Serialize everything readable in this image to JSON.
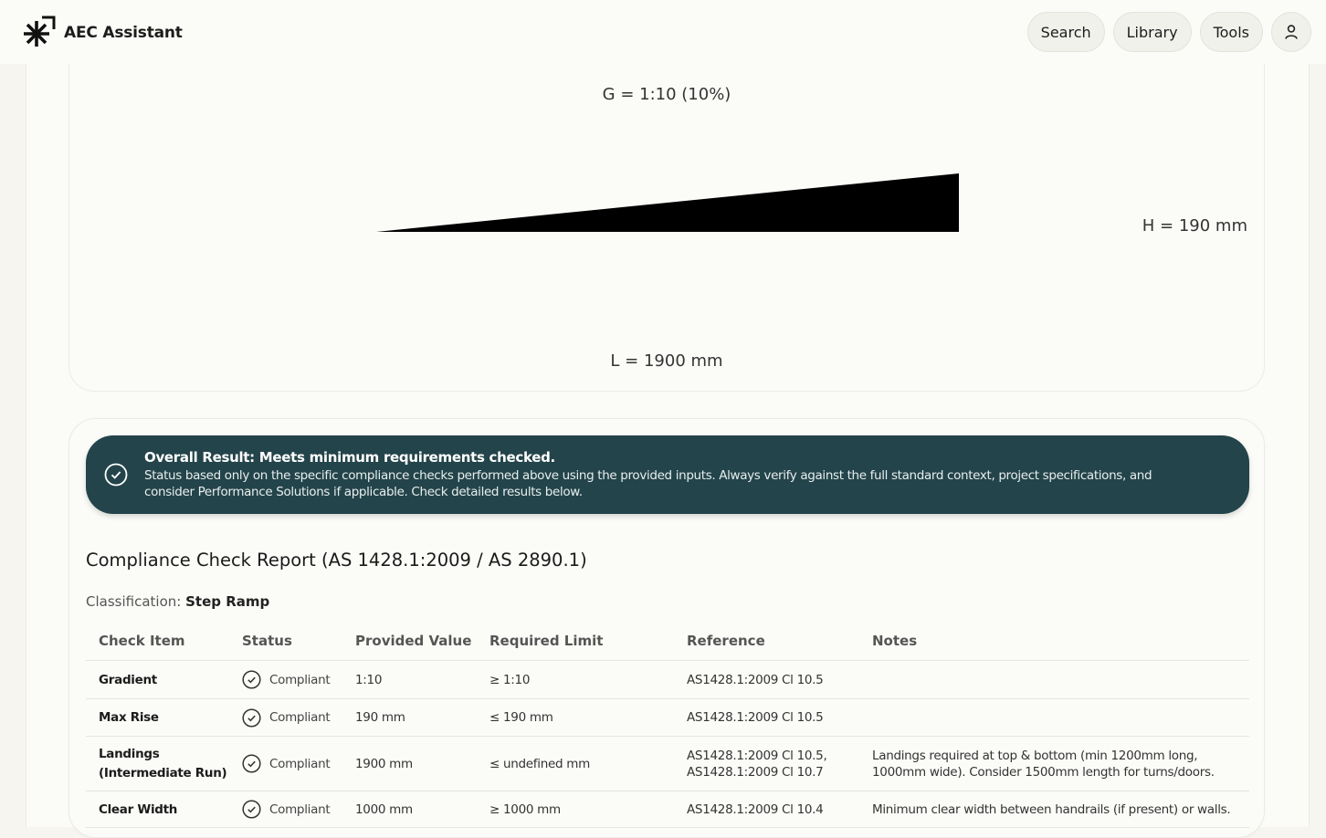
{
  "header": {
    "app_name": "AEC Assistant",
    "nav": [
      {
        "label": "Search"
      },
      {
        "label": "Library"
      },
      {
        "label": "Tools"
      }
    ],
    "account_icon": "user-icon"
  },
  "diagram": {
    "gradient_label": "G = 1:10 (10%)",
    "height_label": "H = 190 mm",
    "length_label": "L = 1900 mm"
  },
  "result": {
    "icon": "check-circle-icon",
    "title": "Overall Result: Meets minimum requirements checked.",
    "text": "Status based only on the specific compliance checks performed above using the provided inputs. Always verify against the full standard context, project specifications, and consider Performance Solutions if applicable. Check detailed results below."
  },
  "report": {
    "title": "Compliance Check Report (AS 1428.1:2009 / AS 2890.1)",
    "classification_label": "Classification:",
    "classification_value": "Step Ramp",
    "columns": [
      "Check Item",
      "Status",
      "Provided Value",
      "Required Limit",
      "Reference",
      "Notes"
    ],
    "rows": [
      {
        "item": "Gradient",
        "status": "Compliant",
        "provided": "1:10",
        "required": "≥ 1:10",
        "reference": "AS1428.1:2009 Cl 10.5",
        "notes": ""
      },
      {
        "item": "Max Rise",
        "status": "Compliant",
        "provided": "190 mm",
        "required": "≤ 190 mm",
        "reference": "AS1428.1:2009 Cl 10.5",
        "notes": ""
      },
      {
        "item": "Landings (Intermediate Run)",
        "status": "Compliant",
        "provided": "1900 mm",
        "required": "≤ undefined mm",
        "reference": "AS1428.1:2009 Cl 10.5, AS1428.1:2009 Cl 10.7",
        "notes": "Landings required at top & bottom (min 1200mm long, 1000mm wide). Consider 1500mm length for turns/doors."
      },
      {
        "item": "Clear Width",
        "status": "Compliant",
        "provided": "1000 mm",
        "required": "≥ 1000 mm",
        "reference": "AS1428.1:2009 Cl 10.4",
        "notes": "Minimum clear width between handrails (if present) or walls."
      }
    ]
  },
  "colors": {
    "banner_bg": "#23444a",
    "page_bg": "#fbfbf8",
    "ramp_fill": "#000000"
  }
}
